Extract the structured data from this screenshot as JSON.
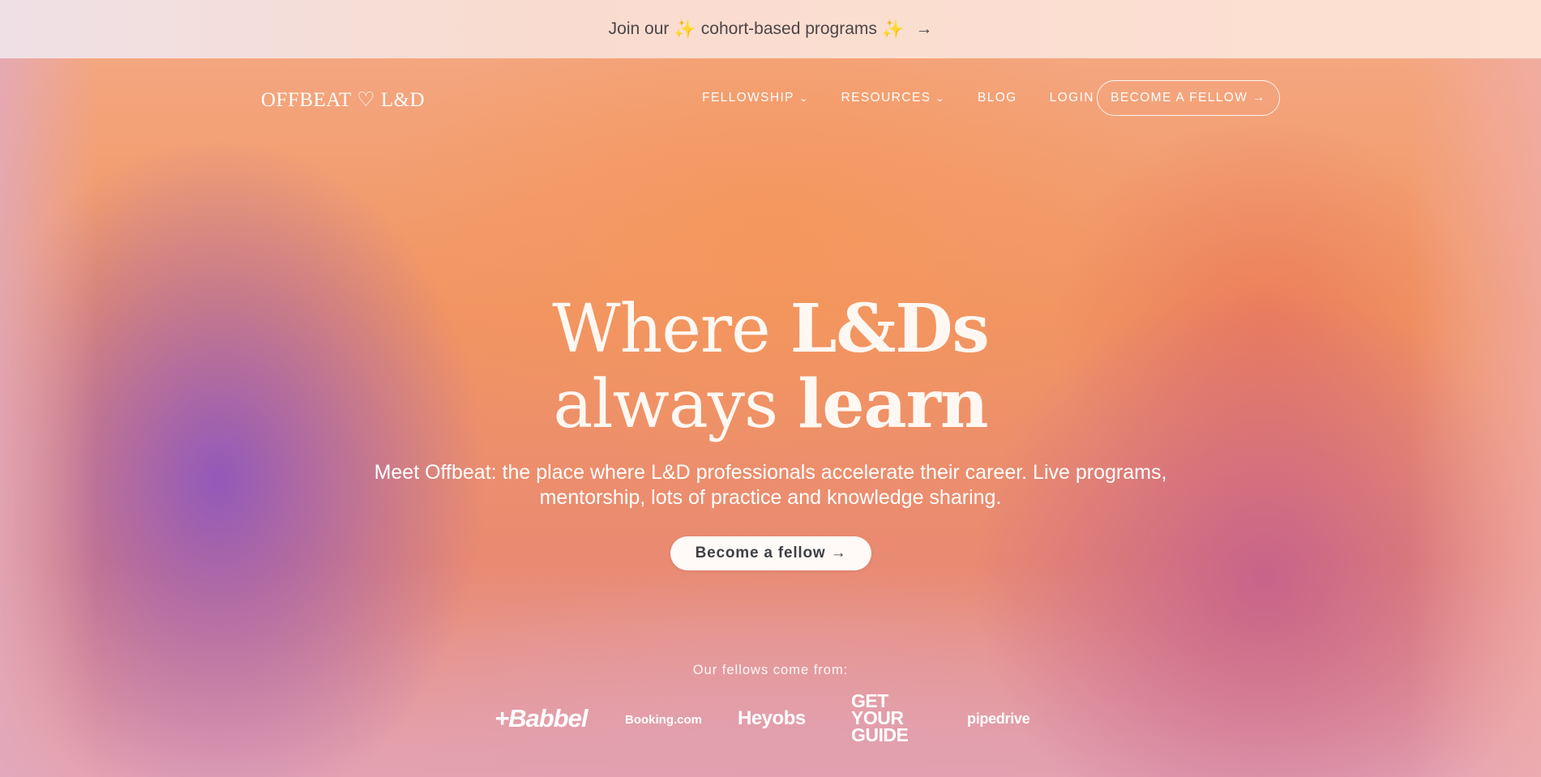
{
  "banner": {
    "prefix": "Join our",
    "spark_icon": "✨",
    "text": "cohort-based programs",
    "arrow": "→"
  },
  "nav": {
    "logo": "OFFBEAT ♡ L&D",
    "items": [
      {
        "label": "FELLOWSHIP",
        "has_dropdown": true
      },
      {
        "label": "RESOURCES",
        "has_dropdown": true
      },
      {
        "label": "BLOG",
        "has_dropdown": false
      },
      {
        "label": "LOGIN",
        "has_dropdown": false
      }
    ],
    "cta": "BECOME A FELLOW →"
  },
  "hero": {
    "line1_light": "Where",
    "line1_bold": "L&Ds",
    "line2_light": "always",
    "line2_bold": "learn",
    "subtitle": "Meet Offbeat: the place where L&D professionals accelerate their career. Live programs, mentorship,  lots of practice and knowledge sharing.",
    "cta": "Become a fellow →"
  },
  "fellows": {
    "label": "Our fellows come from:",
    "logos": {
      "babbel": "+Babbel",
      "booking": "Booking.com",
      "heyjobs": "Heyobs",
      "gyg_line1": "GET",
      "gyg_line2": "YOUR",
      "gyg_line3": "GUIDE",
      "pipedrive": "pipedrive"
    }
  },
  "colors": {
    "accent_orange": "#f19563",
    "accent_purple": "#8e56be",
    "button_bg": "#fffaf7",
    "button_text": "#3f3f46"
  }
}
